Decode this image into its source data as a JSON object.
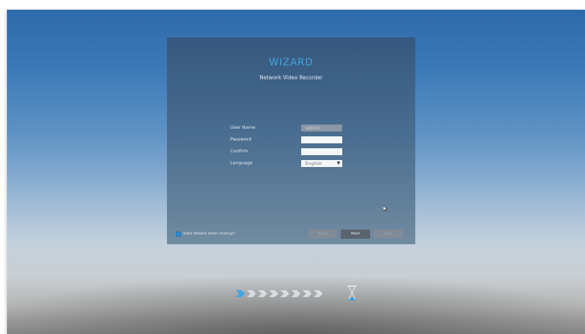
{
  "wizard": {
    "title": "WIZARD",
    "subtitle": "Network Video Recorder",
    "fields": {
      "username_label": "User Name",
      "username_value": "admin",
      "password_label": "Password",
      "password_value": "",
      "confirm_label": "Confirm",
      "confirm_value": "",
      "language_label": "Language",
      "language_value": "English"
    },
    "startup_checkbox": {
      "label": "Start Wizard when startup?",
      "checked": true
    },
    "buttons": {
      "back": "Back",
      "next": "Next",
      "skip": "Skip"
    }
  },
  "progress": {
    "current_step": 1,
    "total_steps": 8
  },
  "colors": {
    "accent": "#3ea6e4",
    "checkbox": "#2a8fd9"
  },
  "icons": {
    "progress_step": "chevron-arrow-icon",
    "loading": "hourglass-icon",
    "cursor": "mouse-pointer-icon"
  }
}
